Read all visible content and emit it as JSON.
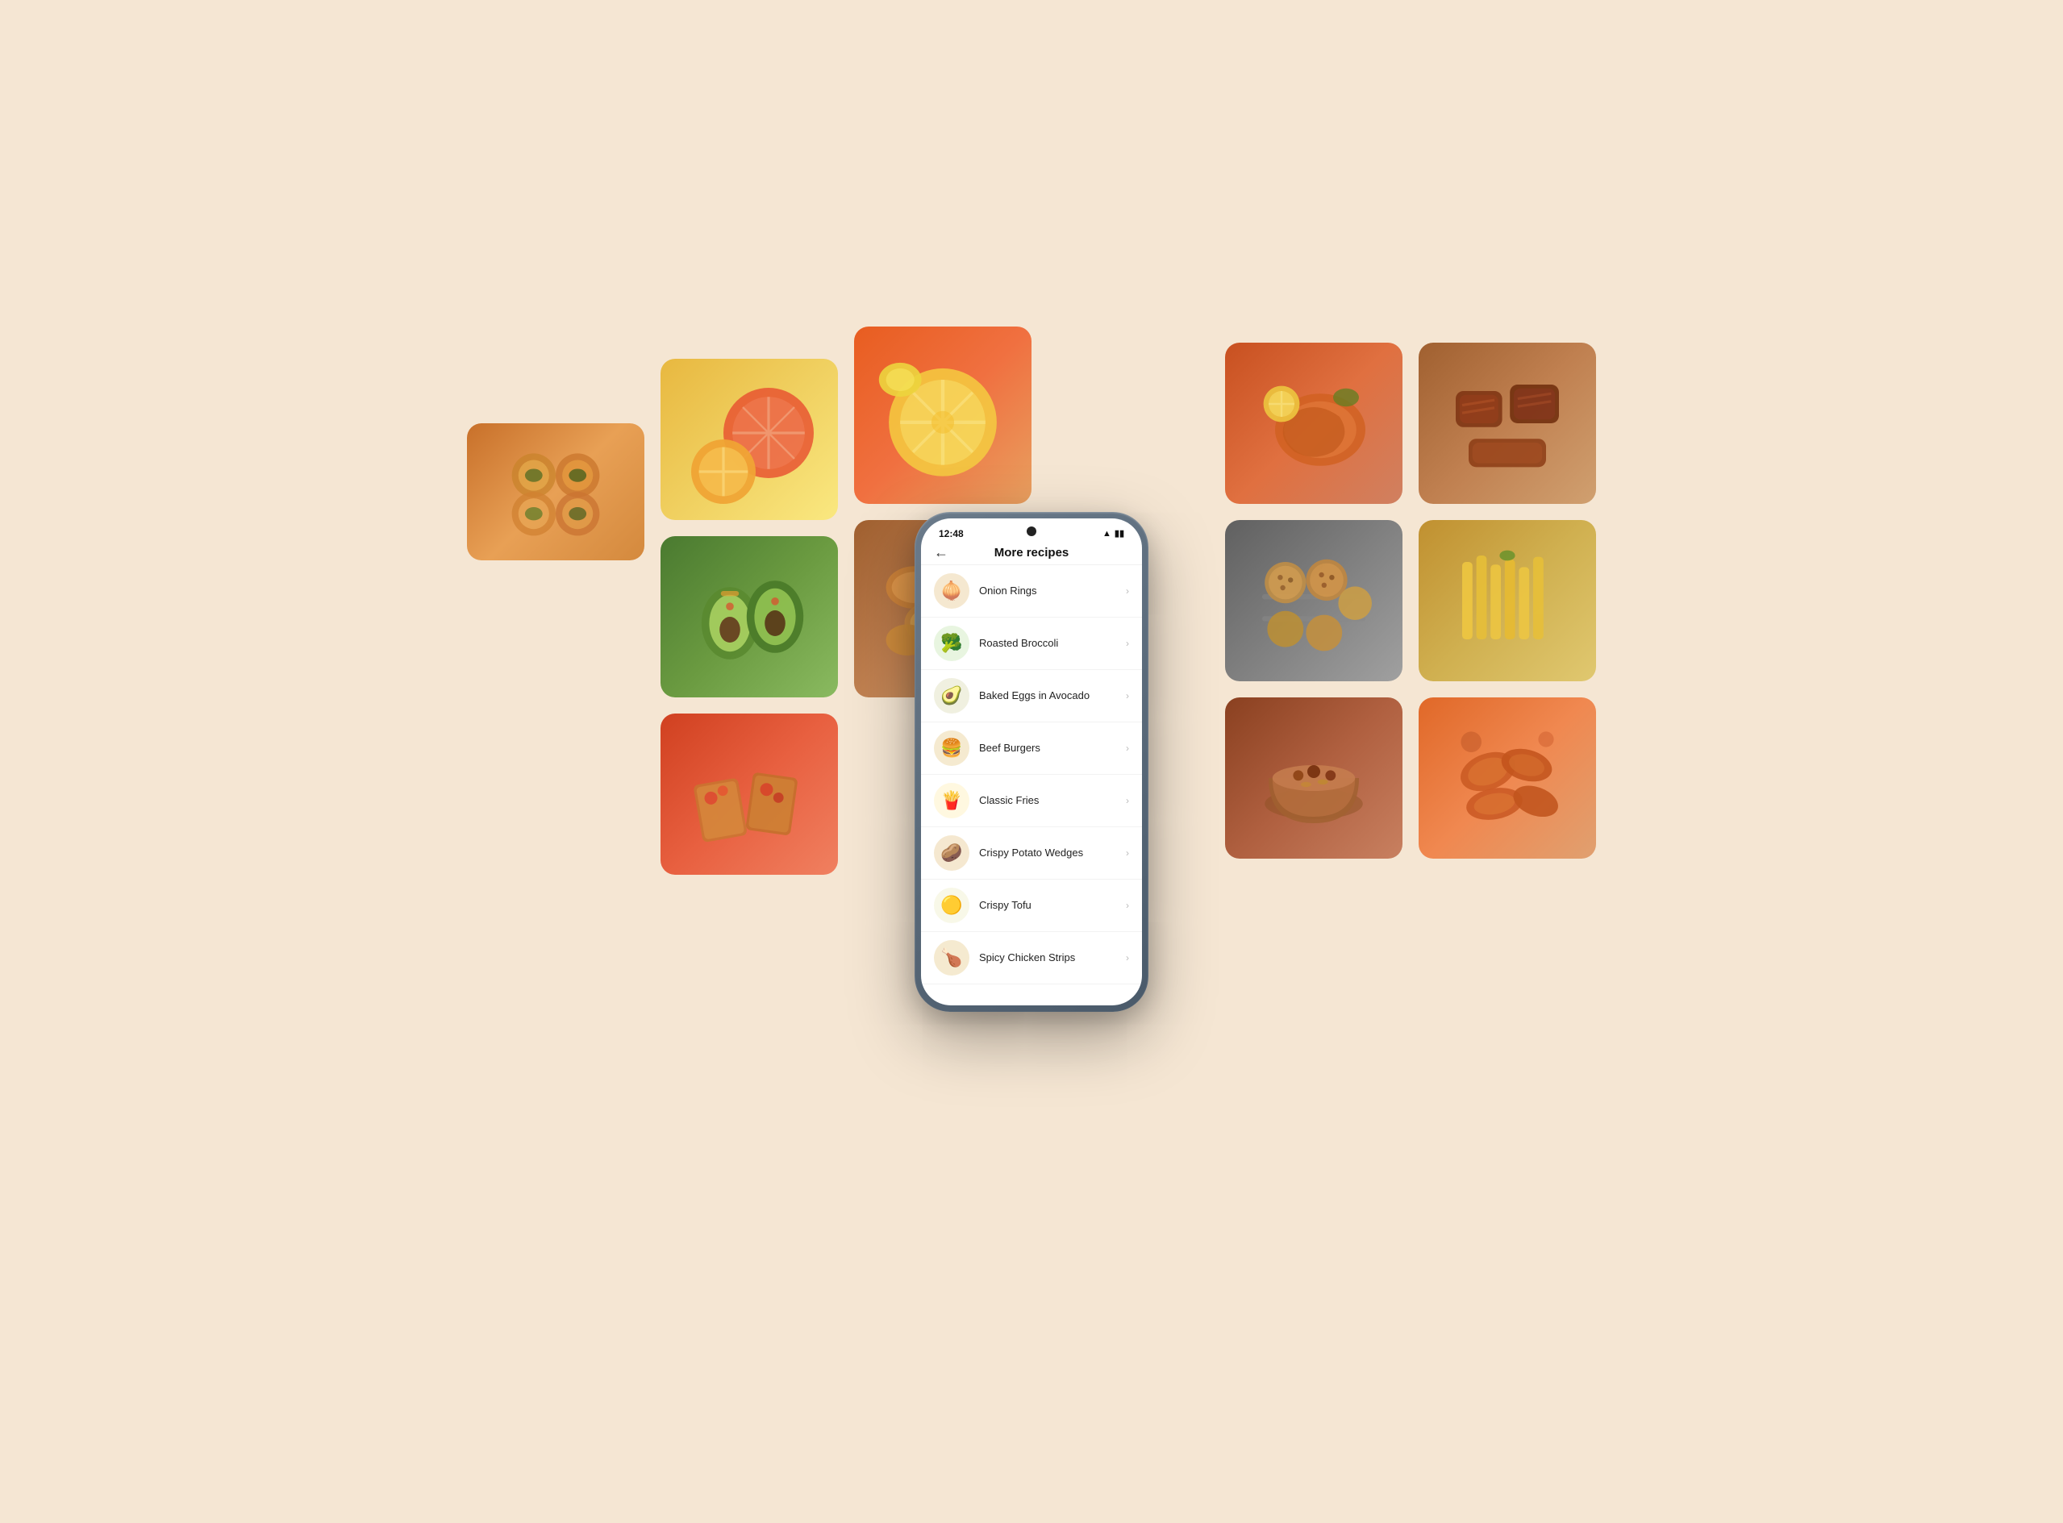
{
  "background_color": "#f5e6d3",
  "status_bar": {
    "time": "12:48",
    "wifi_icon": "wifi",
    "battery_icon": "battery"
  },
  "app": {
    "title": "More recipes",
    "back_label": "←"
  },
  "recipes": [
    {
      "id": "onion-rings",
      "name": "Onion Rings",
      "emoji": "🧅"
    },
    {
      "id": "roasted-broccoli",
      "name": "Roasted Broccoli",
      "emoji": "🥦"
    },
    {
      "id": "baked-eggs-avocado",
      "name": "Baked Eggs in Avocado",
      "emoji": "🥑"
    },
    {
      "id": "beef-burgers",
      "name": "Beef Burgers",
      "emoji": "🍔"
    },
    {
      "id": "classic-fries",
      "name": "Classic Fries",
      "emoji": "🍟"
    },
    {
      "id": "crispy-potato-wedges",
      "name": "Crispy Potato Wedges",
      "emoji": "🥔"
    },
    {
      "id": "crispy-tofu",
      "name": "Crispy Tofu",
      "emoji": "🟡"
    },
    {
      "id": "spicy-chicken-strips",
      "name": "Spicy Chicken Strips",
      "emoji": "🍗"
    }
  ],
  "food_tiles": [
    {
      "id": "tile-l1",
      "label": "pastry-tarts",
      "emoji": "🥧"
    },
    {
      "id": "tile-l2",
      "label": "citrus-fruit",
      "emoji": "🍊"
    },
    {
      "id": "tile-l3",
      "label": "avocado-toast",
      "emoji": "🥑"
    },
    {
      "id": "tile-l4",
      "label": "citrus-slices",
      "emoji": "🍋"
    },
    {
      "id": "tile-l5",
      "label": "fried-food",
      "emoji": "🍤"
    },
    {
      "id": "tile-l6",
      "label": "bruschetta",
      "emoji": "🍅"
    },
    {
      "id": "tile-r1",
      "label": "grilled-chicken",
      "emoji": "🍗"
    },
    {
      "id": "tile-r2",
      "label": "grilled-meat",
      "emoji": "🥩"
    },
    {
      "id": "tile-r3",
      "label": "cookies",
      "emoji": "🍪"
    },
    {
      "id": "tile-r4",
      "label": "french-fries",
      "emoji": "🍟"
    },
    {
      "id": "tile-r5",
      "label": "dessert",
      "emoji": "🍮"
    },
    {
      "id": "tile-r6",
      "label": "chicken-wings",
      "emoji": "🍗"
    }
  ]
}
